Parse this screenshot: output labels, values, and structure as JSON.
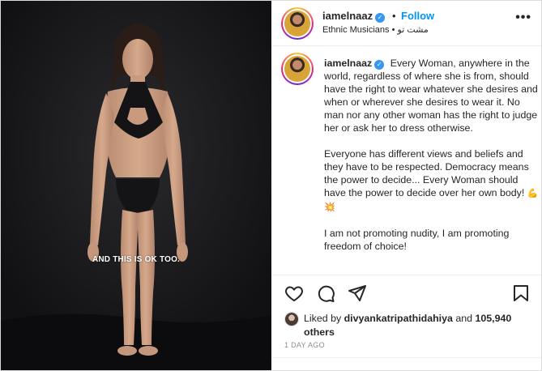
{
  "media": {
    "overlay_caption": "AND THIS IS OK TOO."
  },
  "header": {
    "username": "iamelnaaz",
    "separator": "•",
    "follow_label": "Follow",
    "subtitle": "Ethnic Musicians • مشت تو",
    "more_label": "•••"
  },
  "post": {
    "username": "iamelnaaz",
    "paragraph_1": "Every Woman, anywhere in the world, regardless of where she is from, should have the right to wear whatever she desires and when or wherever she desires to wear it. No man nor any other woman has the right to judge her or ask her to dress otherwise.",
    "paragraph_2": "Everyone has different views and beliefs and they have to be respected. Democracy means the power to decide... Every Woman should have the power to decide over her own body!",
    "paragraph_2_emoji": "💪💥",
    "paragraph_3": "I am not promoting nudity, I am promoting freedom of choice!"
  },
  "actions": {
    "like_icon": "heart-icon",
    "comment_icon": "comment-icon",
    "share_icon": "paper-plane-icon",
    "save_icon": "bookmark-icon"
  },
  "likes": {
    "prefix": "Liked by",
    "liker": "divyankatripathidahiya",
    "joiner": "and",
    "others": "105,940 others"
  },
  "timestamp": "1 DAY AGO",
  "colors": {
    "follow_blue": "#0095f6",
    "verified_blue": "#3897f0",
    "text_dark": "#262626",
    "text_muted": "#8e8e8e"
  }
}
